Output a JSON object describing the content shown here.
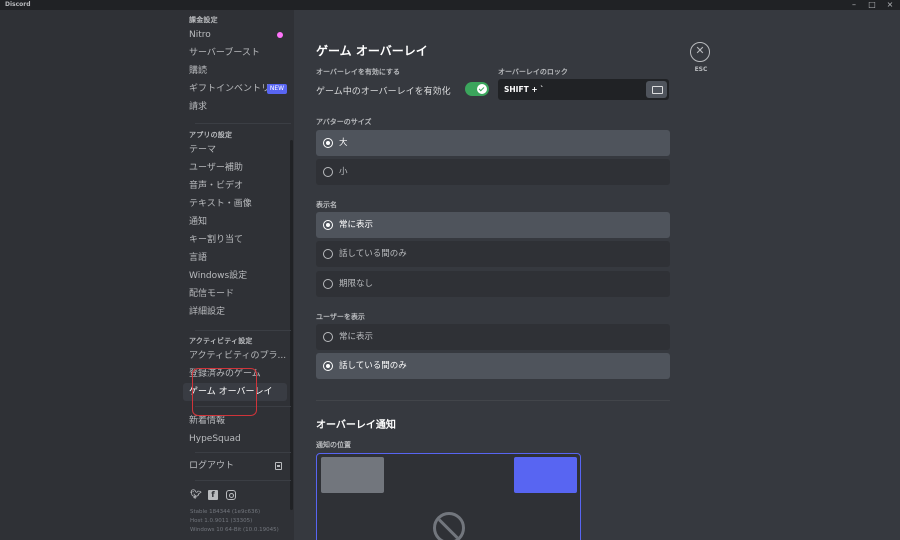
{
  "titlebar": {
    "app_name": "Discord"
  },
  "window_controls": [
    "–",
    "□",
    "×"
  ],
  "sidebar": {
    "section_user": "課金設定",
    "billing_items": [
      {
        "label": "Nitro",
        "icon": "nitro-icon"
      },
      {
        "label": "サーバーブースト"
      },
      {
        "label": "購読"
      },
      {
        "label": "ギフトインベントリ",
        "badge": "NEW"
      },
      {
        "label": "請求"
      }
    ],
    "section_app": "アプリの設定",
    "app_items": [
      {
        "label": "テーマ"
      },
      {
        "label": "ユーザー補助"
      },
      {
        "label": "音声・ビデオ"
      },
      {
        "label": "テキスト・画像"
      },
      {
        "label": "通知"
      },
      {
        "label": "キー割り当て"
      },
      {
        "label": "言語"
      },
      {
        "label": "Windows設定"
      },
      {
        "label": "配信モード"
      },
      {
        "label": "詳細設定"
      }
    ],
    "section_activity": "アクティビティ設定",
    "activity_items": [
      {
        "label": "アクティビティのプラ..."
      },
      {
        "label": "登録済みのゲーム"
      },
      {
        "label": "ゲーム オーバーレイ",
        "selected": true
      }
    ],
    "misc_items": [
      {
        "label": "新着情報"
      },
      {
        "label": "HypeSquad"
      }
    ],
    "logout": "ログアウト",
    "social_icons": [
      "twitter-icon",
      "facebook-icon",
      "instagram-icon"
    ],
    "version_lines": [
      "Stable 184344 (1e9c636)",
      "Host 1.0.9011 (33305)",
      "Windows 10 64-Bit (10.0.19045)"
    ]
  },
  "main": {
    "title": "ゲーム オーバーレイ",
    "enable_label": "オーバーレイを有効にする",
    "enable_text": "ゲーム中のオーバーレイを有効化",
    "enable_checked": true,
    "lock_label": "オーバーレイのロック",
    "lock_value": "SHIFT + `",
    "close_label": "ESC",
    "avatar_size_label": "アバターのサイズ",
    "avatar_size_options": [
      {
        "label": "大",
        "checked": true
      },
      {
        "label": "小",
        "checked": false
      }
    ],
    "display_names_label": "表示名",
    "display_names_options": [
      {
        "label": "常に表示",
        "checked": true
      },
      {
        "label": "話している間のみ",
        "checked": false
      },
      {
        "label": "期限なし",
        "checked": false
      }
    ],
    "display_users_label": "ユーザーを表示",
    "display_users_options": [
      {
        "label": "常に表示",
        "checked": false
      },
      {
        "label": "話している間のみ",
        "checked": true
      }
    ],
    "notifications_title": "オーバーレイ通知",
    "notification_position_label": "通知の位置",
    "notification_position_selected": "top-right"
  },
  "colors": {
    "accent": "#5865f2",
    "toggle_on": "#3ba55c",
    "nitro": "#ff73fa",
    "annotation": "#d0343a"
  }
}
